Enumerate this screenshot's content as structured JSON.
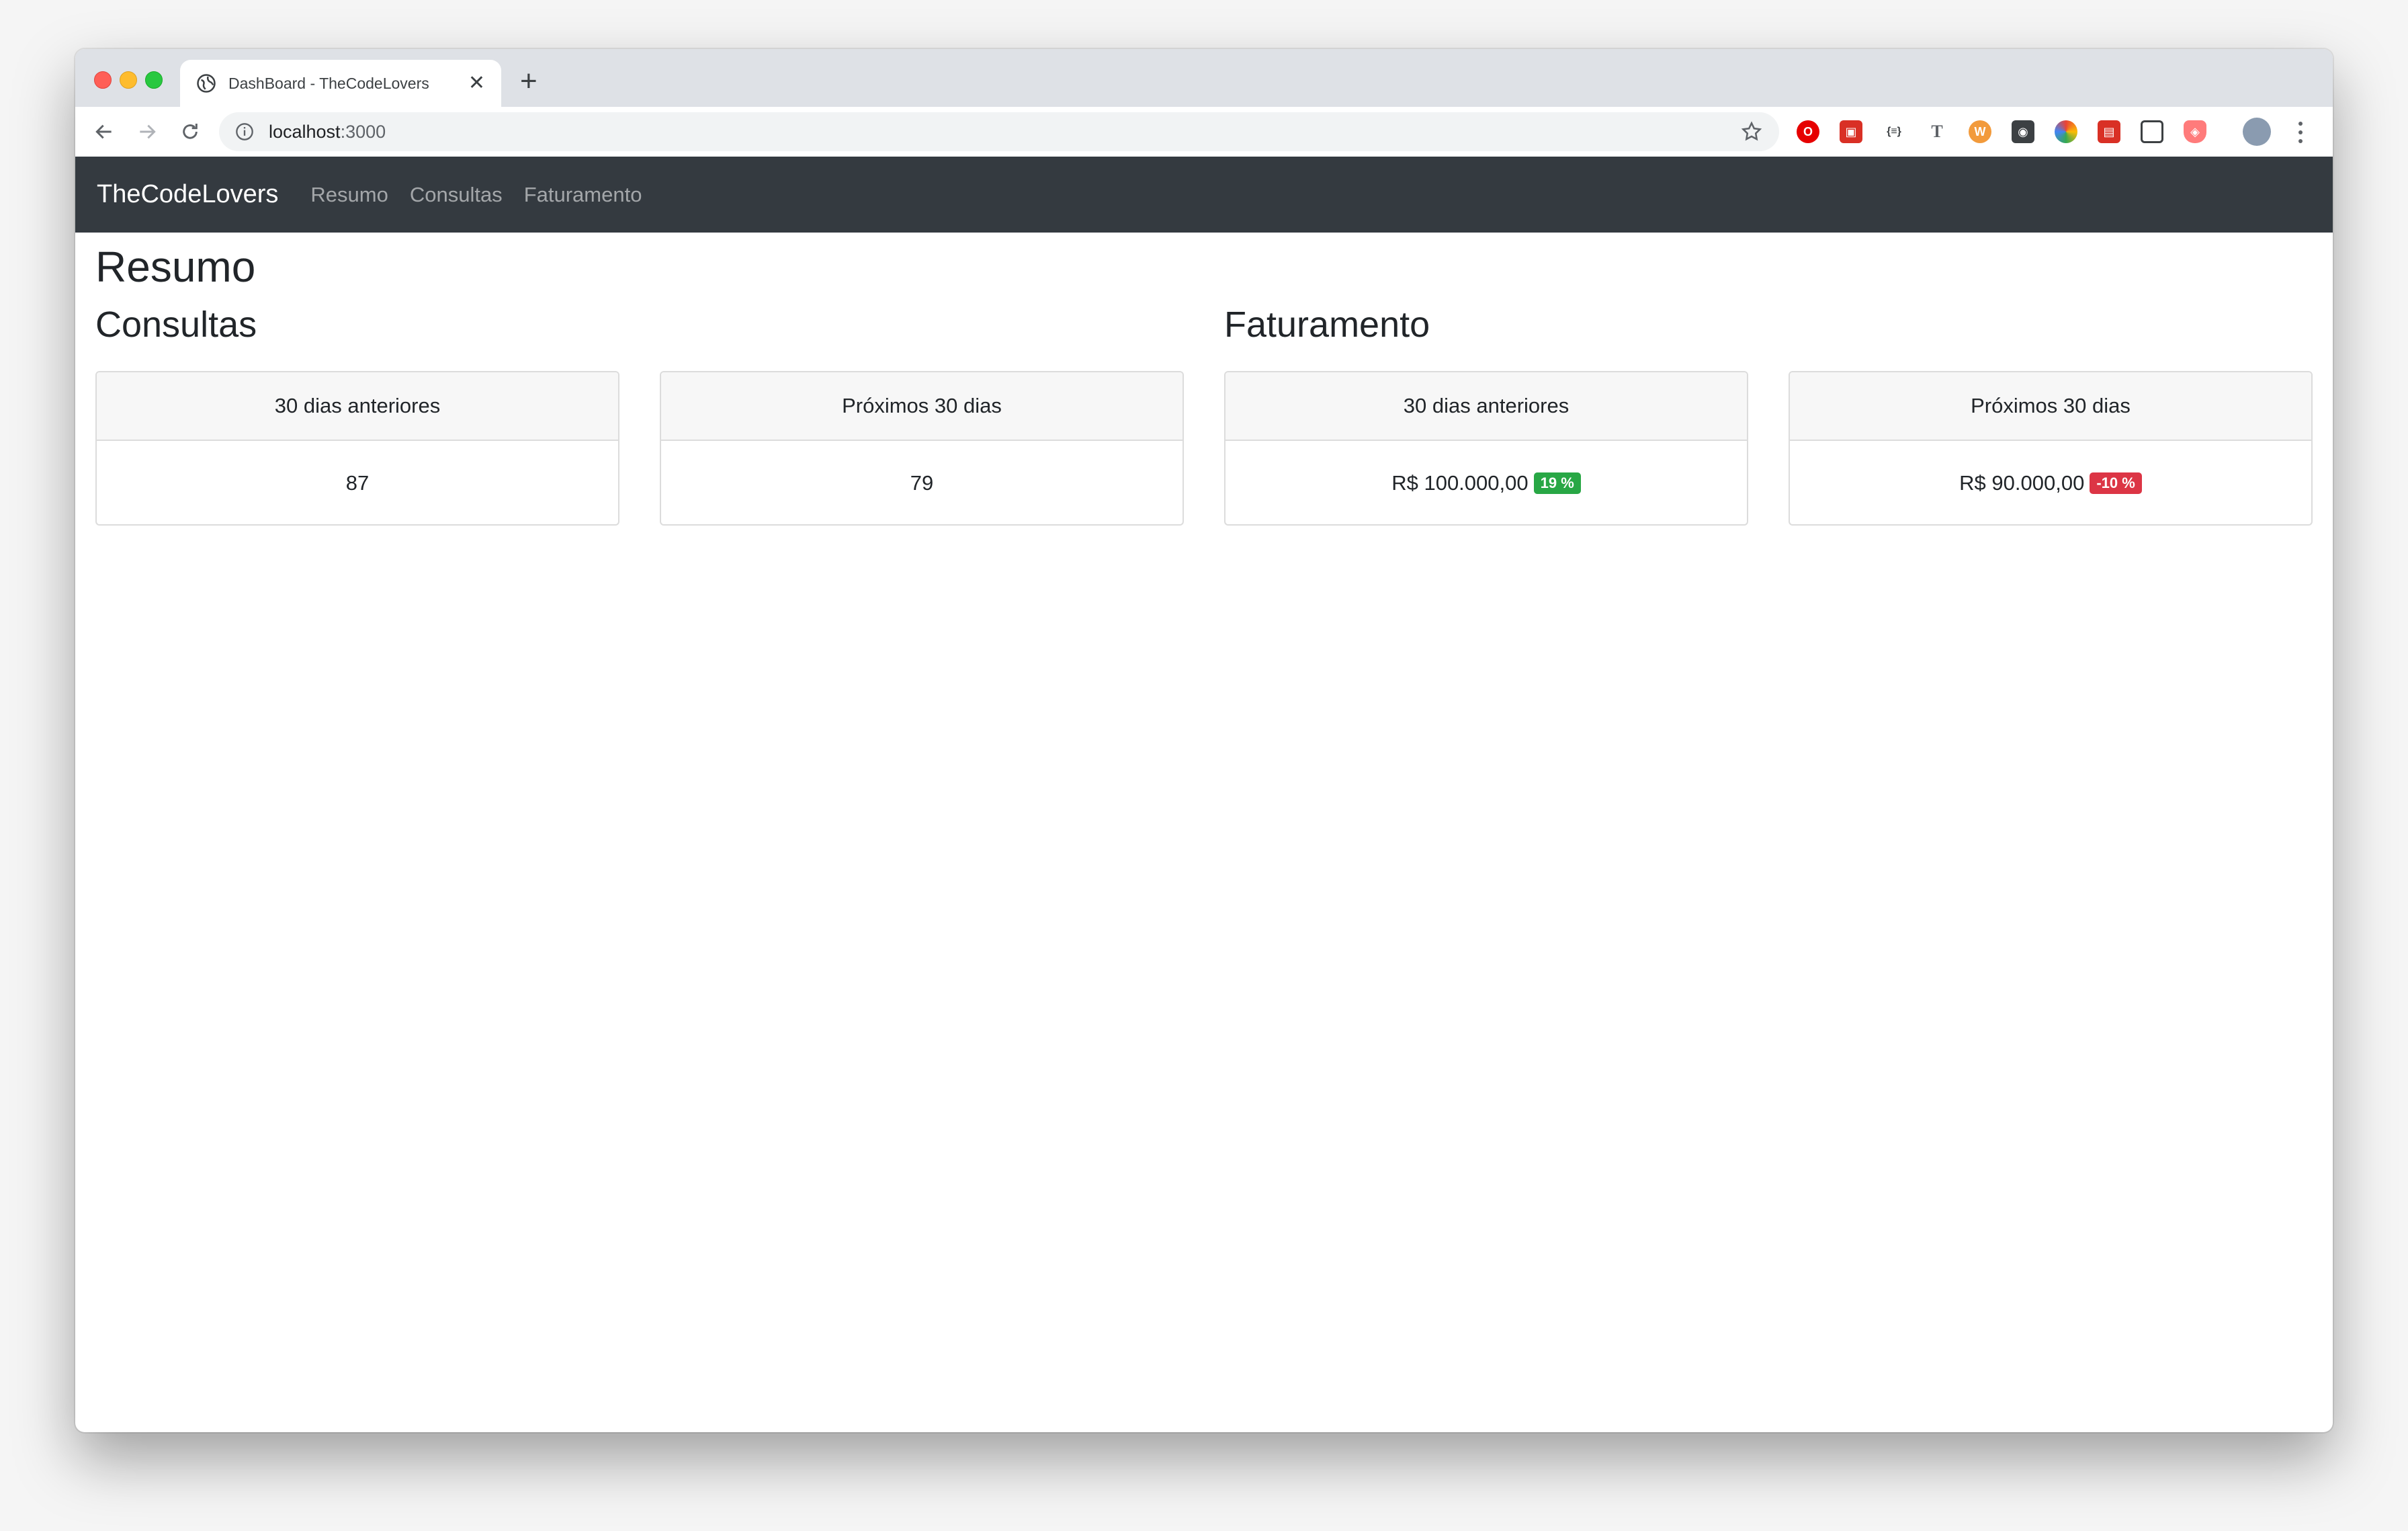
{
  "browser": {
    "tab_title": "DashBoard - TheCodeLovers",
    "tab_close": "✕",
    "new_tab": "+",
    "url_host": "localhost",
    "url_port": ":3000",
    "extensions": [
      "opera-icon",
      "puzzle-icon",
      "json-icon",
      "font-icon",
      "wordpress-icon",
      "lighthouse-icon",
      "color-wheel-icon",
      "toolbox-icon",
      "screenshot-icon",
      "shield-icon"
    ]
  },
  "navbar": {
    "brand": "TheCodeLovers",
    "links": [
      "Resumo",
      "Consultas",
      "Faturamento"
    ]
  },
  "page": {
    "title": "Resumo",
    "consultas": {
      "heading": "Consultas",
      "cards": [
        {
          "header": "30 dias anteriores",
          "value": "87"
        },
        {
          "header": "Próximos 30 dias",
          "value": "79"
        }
      ]
    },
    "faturamento": {
      "heading": "Faturamento",
      "cards": [
        {
          "header": "30 dias anteriores",
          "value": "R$ 100.000,00",
          "badge": "19 %"
        },
        {
          "header": "Próximos 30 dias",
          "value": "R$ 90.000,00",
          "badge": "-10 %"
        }
      ]
    }
  },
  "colors": {
    "navbar_bg": "#343a40",
    "badge_up": "#28a745",
    "badge_down": "#dc3545"
  }
}
